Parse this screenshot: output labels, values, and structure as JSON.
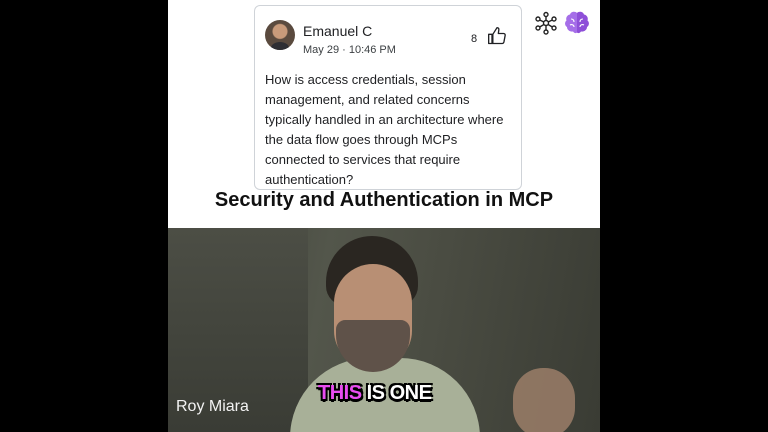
{
  "comment_card": {
    "author": "Emanuel C",
    "date": "May 29 · 10:46 PM",
    "likes": "8",
    "text": "How is access credentials, session management, and related concerns typically handled in an architecture where the data flow goes through MCPs connected to services that require authentication?"
  },
  "icons": {
    "network": "network-nodes-icon",
    "brain": "brain-icon",
    "like": "thumbs-up-icon"
  },
  "title": "Security and Authentication in MCP",
  "video": {
    "speaker_name": "Roy Miara",
    "caption_highlight": "THIS",
    "caption_rest": " IS ONE"
  },
  "colors": {
    "caption_highlight": "#e84df0",
    "brain_icon": "#9b5de5"
  }
}
